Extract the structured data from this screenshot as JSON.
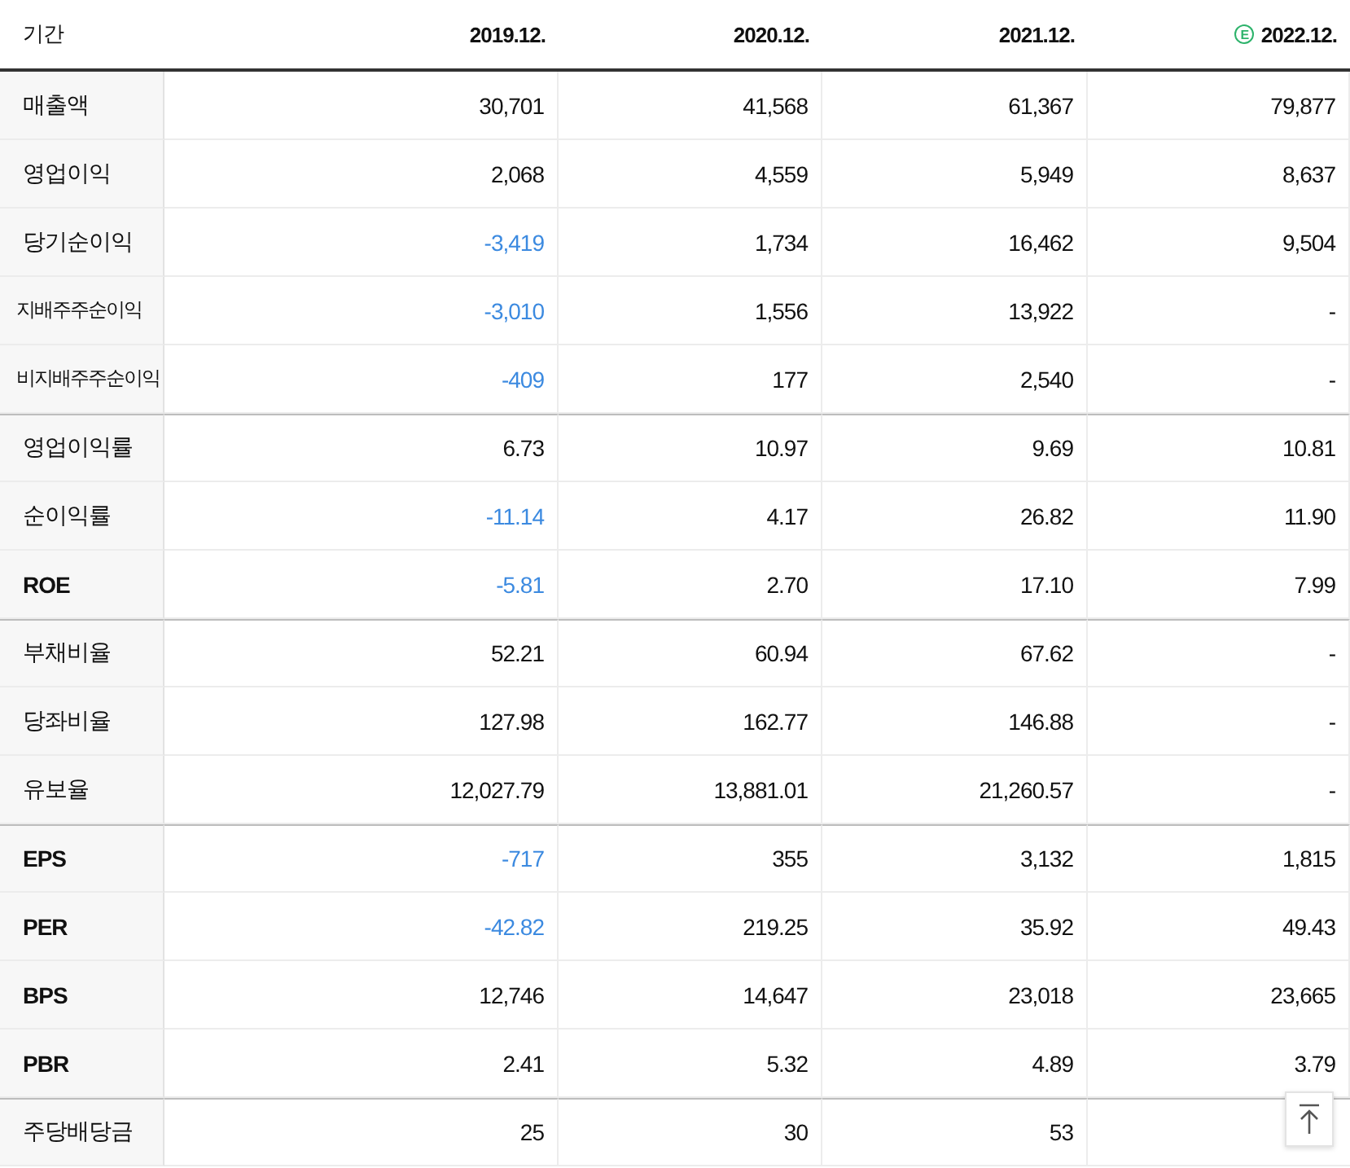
{
  "table": {
    "columns": [
      {
        "label": "기간"
      },
      {
        "label": "2019.12."
      },
      {
        "label": "2020.12."
      },
      {
        "label": "2021.12."
      },
      {
        "label": "2022.12.",
        "badge": "E"
      }
    ],
    "groups": [
      {
        "rows": [
          {
            "label": "매출액",
            "cells": [
              {
                "value": "30,701",
                "negative": false
              },
              {
                "value": "41,568",
                "negative": false
              },
              {
                "value": "61,367",
                "negative": false
              },
              {
                "value": "79,877",
                "negative": false
              }
            ]
          },
          {
            "label": "영업이익",
            "cells": [
              {
                "value": "2,068",
                "negative": false
              },
              {
                "value": "4,559",
                "negative": false
              },
              {
                "value": "5,949",
                "negative": false
              },
              {
                "value": "8,637",
                "negative": false
              }
            ]
          },
          {
            "label": "당기순이익",
            "cells": [
              {
                "value": "-3,419",
                "negative": true
              },
              {
                "value": "1,734",
                "negative": false
              },
              {
                "value": "16,462",
                "negative": false
              },
              {
                "value": "9,504",
                "negative": false
              }
            ]
          },
          {
            "label": "지배주주순이익",
            "cells": [
              {
                "value": "-3,010",
                "negative": true
              },
              {
                "value": "1,556",
                "negative": false
              },
              {
                "value": "13,922",
                "negative": false
              },
              {
                "value": "-",
                "negative": false
              }
            ]
          },
          {
            "label": "비지배주주순이익",
            "cells": [
              {
                "value": "-409",
                "negative": true
              },
              {
                "value": "177",
                "negative": false
              },
              {
                "value": "2,540",
                "negative": false
              },
              {
                "value": "-",
                "negative": false
              }
            ]
          }
        ]
      },
      {
        "rows": [
          {
            "label": "영업이익률",
            "cells": [
              {
                "value": "6.73",
                "negative": false
              },
              {
                "value": "10.97",
                "negative": false
              },
              {
                "value": "9.69",
                "negative": false
              },
              {
                "value": "10.81",
                "negative": false
              }
            ]
          },
          {
            "label": "순이익률",
            "cells": [
              {
                "value": "-11.14",
                "negative": true
              },
              {
                "value": "4.17",
                "negative": false
              },
              {
                "value": "26.82",
                "negative": false
              },
              {
                "value": "11.90",
                "negative": false
              }
            ]
          },
          {
            "label": "ROE",
            "cells": [
              {
                "value": "-5.81",
                "negative": true
              },
              {
                "value": "2.70",
                "negative": false
              },
              {
                "value": "17.10",
                "negative": false
              },
              {
                "value": "7.99",
                "negative": false
              }
            ]
          }
        ]
      },
      {
        "rows": [
          {
            "label": "부채비율",
            "cells": [
              {
                "value": "52.21",
                "negative": false
              },
              {
                "value": "60.94",
                "negative": false
              },
              {
                "value": "67.62",
                "negative": false
              },
              {
                "value": "-",
                "negative": false
              }
            ]
          },
          {
            "label": "당좌비율",
            "cells": [
              {
                "value": "127.98",
                "negative": false
              },
              {
                "value": "162.77",
                "negative": false
              },
              {
                "value": "146.88",
                "negative": false
              },
              {
                "value": "-",
                "negative": false
              }
            ]
          },
          {
            "label": "유보율",
            "cells": [
              {
                "value": "12,027.79",
                "negative": false
              },
              {
                "value": "13,881.01",
                "negative": false
              },
              {
                "value": "21,260.57",
                "negative": false
              },
              {
                "value": "-",
                "negative": false
              }
            ]
          }
        ]
      },
      {
        "rows": [
          {
            "label": "EPS",
            "cells": [
              {
                "value": "-717",
                "negative": true
              },
              {
                "value": "355",
                "negative": false
              },
              {
                "value": "3,132",
                "negative": false
              },
              {
                "value": "1,815",
                "negative": false
              }
            ]
          },
          {
            "label": "PER",
            "cells": [
              {
                "value": "-42.82",
                "negative": true
              },
              {
                "value": "219.25",
                "negative": false
              },
              {
                "value": "35.92",
                "negative": false
              },
              {
                "value": "49.43",
                "negative": false
              }
            ]
          },
          {
            "label": "BPS",
            "cells": [
              {
                "value": "12,746",
                "negative": false
              },
              {
                "value": "14,647",
                "negative": false
              },
              {
                "value": "23,018",
                "negative": false
              },
              {
                "value": "23,665",
                "negative": false
              }
            ]
          },
          {
            "label": "PBR",
            "cells": [
              {
                "value": "2.41",
                "negative": false
              },
              {
                "value": "5.32",
                "negative": false
              },
              {
                "value": "4.89",
                "negative": false
              },
              {
                "value": "3.79",
                "negative": false
              }
            ]
          }
        ]
      },
      {
        "rows": [
          {
            "label": "주당배당금",
            "cells": [
              {
                "value": "25",
                "negative": false
              },
              {
                "value": "30",
                "negative": false
              },
              {
                "value": "53",
                "negative": false
              }
            ]
          }
        ]
      }
    ]
  },
  "scroll_top_button": {
    "kind": "arrow-up"
  }
}
